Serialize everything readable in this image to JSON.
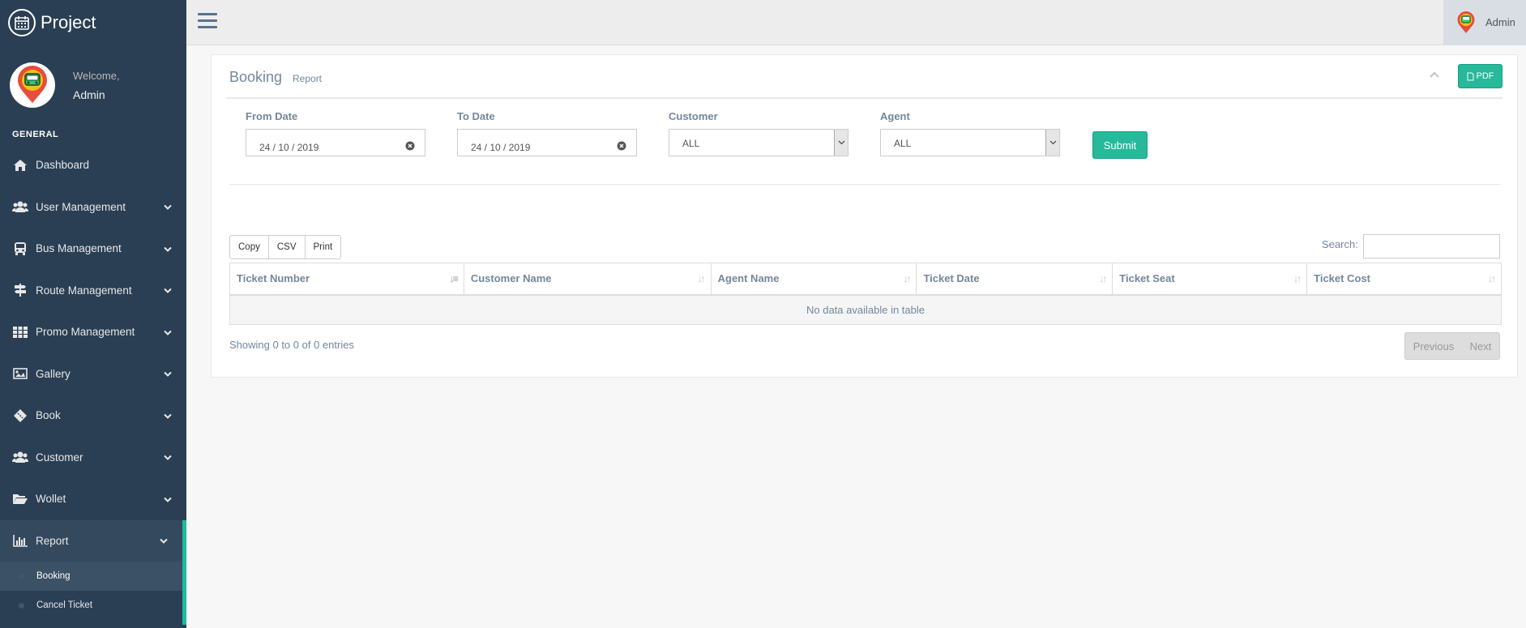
{
  "brand": {
    "title": "Project",
    "icon": "calendar-icon"
  },
  "profile": {
    "welcome": "Welcome,",
    "name": "Admin"
  },
  "sidebar": {
    "section": "GENERAL",
    "items": [
      {
        "label": "Dashboard",
        "icon": "home-icon",
        "has_children": false
      },
      {
        "label": "User Management",
        "icon": "users-icon",
        "has_children": true
      },
      {
        "label": "Bus Management",
        "icon": "bus-icon",
        "has_children": true
      },
      {
        "label": "Route Management",
        "icon": "signpost-icon",
        "has_children": true
      },
      {
        "label": "Promo Management",
        "icon": "grid-icon",
        "has_children": true
      },
      {
        "label": "Gallery",
        "icon": "image-icon",
        "has_children": true
      },
      {
        "label": "Book",
        "icon": "ticket-icon",
        "has_children": true
      },
      {
        "label": "Customer",
        "icon": "users-icon",
        "has_children": true
      },
      {
        "label": "Wollet",
        "icon": "folder-open-icon",
        "has_children": true
      },
      {
        "label": "Report",
        "icon": "bar-chart-icon",
        "has_children": true,
        "active": true
      }
    ],
    "report_children": [
      {
        "label": "Booking",
        "current": true
      },
      {
        "label": "Cancel Ticket",
        "current": false
      }
    ]
  },
  "topbar": {
    "user": "Admin"
  },
  "panel": {
    "title": "Booking",
    "subtitle": "Report",
    "pdf_label": "PDF"
  },
  "filters": {
    "from_date": {
      "label": "From Date",
      "value": "24 / 10 / 2019"
    },
    "to_date": {
      "label": "To Date",
      "value": "24 / 10 / 2019"
    },
    "customer": {
      "label": "Customer",
      "value": "ALL"
    },
    "agent": {
      "label": "Agent",
      "value": "ALL"
    },
    "submit": "Submit"
  },
  "table": {
    "buttons": [
      "Copy",
      "CSV",
      "Print"
    ],
    "search_label": "Search:",
    "columns": [
      "Ticket Number",
      "Customer Name",
      "Agent Name",
      "Ticket Date",
      "Ticket Seat",
      "Ticket Cost"
    ],
    "empty_message": "No data available in table",
    "info": "Showing 0 to 0 of 0 entries",
    "prev": "Previous",
    "next": "Next"
  },
  "colors": {
    "sidebar": "#2a3f54",
    "accent": "#1abb9c",
    "button": "#26b99a"
  }
}
